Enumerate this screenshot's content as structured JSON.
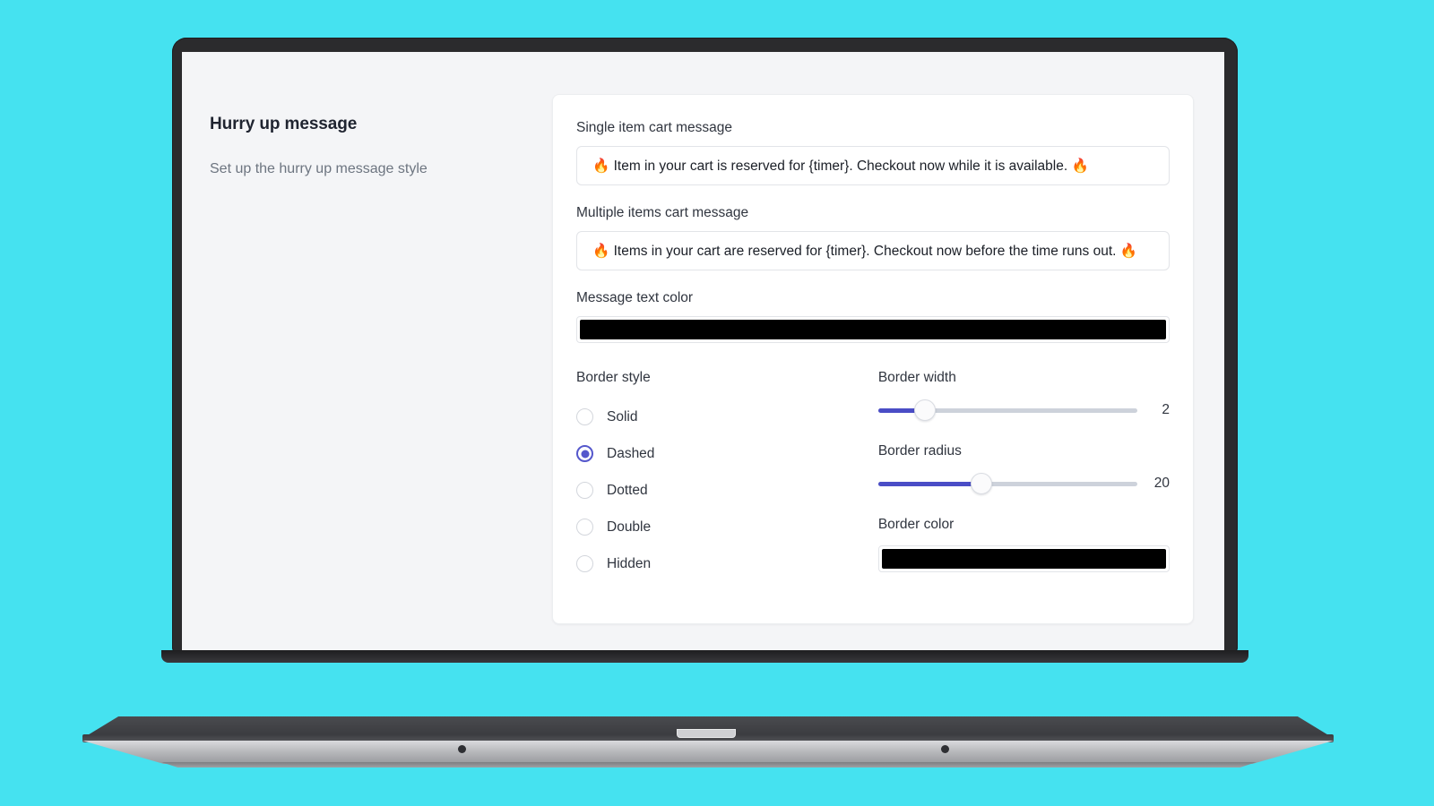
{
  "background_color": "#45e2f0",
  "sidebar": {
    "title": "Hurry up message",
    "subtitle": "Set up the hurry up message style"
  },
  "form": {
    "single_item": {
      "label": "Single item cart message",
      "value": "🔥 Item in your cart is reserved for {timer}. Checkout now while it is available. 🔥",
      "placeholder": "Single item cart message"
    },
    "multiple_items": {
      "label": "Multiple items cart message",
      "value": "🔥 Items in your cart are reserved for {timer}. Checkout now before the time runs out. 🔥",
      "placeholder": "Multiple items cart message"
    },
    "message_text_color": {
      "label": "Message text color",
      "value": "#000000"
    },
    "border_style": {
      "label": "Border style",
      "selected": "Dashed",
      "options": [
        {
          "label": "Solid",
          "selected": false
        },
        {
          "label": "Dashed",
          "selected": true
        },
        {
          "label": "Dotted",
          "selected": false
        },
        {
          "label": "Double",
          "selected": false
        },
        {
          "label": "Hidden",
          "selected": false
        }
      ]
    },
    "border_width": {
      "label": "Border width",
      "value": "2",
      "min": 0,
      "max": 10,
      "percent": 18
    },
    "border_radius": {
      "label": "Border radius",
      "value": "20",
      "min": 0,
      "max": 50,
      "percent": 40
    },
    "border_color": {
      "label": "Border color",
      "value": "#000000"
    }
  },
  "accent_colors": {
    "radio_selected": "#5558cc",
    "slider_fill": "#4a4dc6",
    "slider_track": "#cdd2db"
  }
}
